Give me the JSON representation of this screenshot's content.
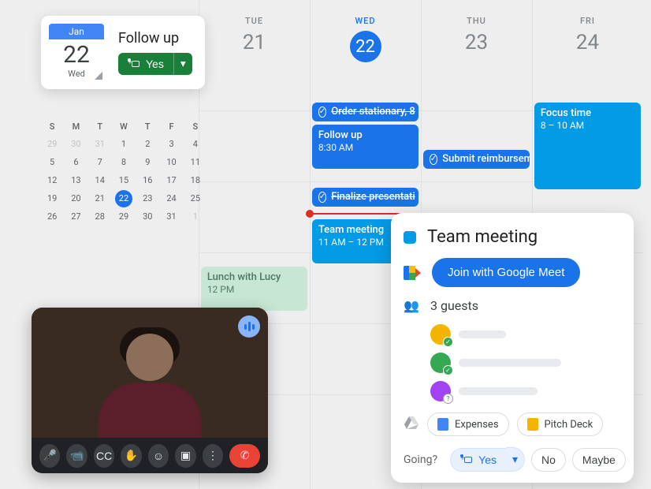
{
  "colors": {
    "blue": "#1a73e8",
    "lightBlue": "#039be5",
    "focusBlue": "#039be5",
    "green": "#188038",
    "lunch": "#c7e7d4"
  },
  "dayHeaders": [
    {
      "dow": "TUE",
      "num": "21",
      "today": false
    },
    {
      "dow": "WED",
      "num": "22",
      "today": true
    },
    {
      "dow": "THU",
      "num": "23",
      "today": false
    },
    {
      "dow": "FRI",
      "num": "24",
      "today": false
    }
  ],
  "rsvpCard": {
    "month": "Jan",
    "day": "22",
    "dow": "Wed",
    "title": "Follow up",
    "yes": "Yes"
  },
  "miniCal": {
    "dow": [
      "S",
      "M",
      "T",
      "W",
      "T",
      "F",
      "S"
    ],
    "weeks": [
      [
        {
          "n": "29",
          "dim": true
        },
        {
          "n": "30",
          "dim": true
        },
        {
          "n": "31",
          "dim": true
        },
        {
          "n": "1"
        },
        {
          "n": "2"
        },
        {
          "n": "3"
        },
        {
          "n": "4"
        }
      ],
      [
        {
          "n": "5"
        },
        {
          "n": "6"
        },
        {
          "n": "7"
        },
        {
          "n": "8"
        },
        {
          "n": "9"
        },
        {
          "n": "10"
        },
        {
          "n": "11"
        }
      ],
      [
        {
          "n": "12"
        },
        {
          "n": "13"
        },
        {
          "n": "14"
        },
        {
          "n": "15"
        },
        {
          "n": "16"
        },
        {
          "n": "17"
        },
        {
          "n": "18"
        }
      ],
      [
        {
          "n": "19"
        },
        {
          "n": "20"
        },
        {
          "n": "21"
        },
        {
          "n": "22",
          "today": true
        },
        {
          "n": "23"
        },
        {
          "n": "24"
        },
        {
          "n": "25"
        }
      ],
      [
        {
          "n": "26"
        },
        {
          "n": "27"
        },
        {
          "n": "28"
        },
        {
          "n": "29"
        },
        {
          "n": "30"
        },
        {
          "n": "31"
        },
        {
          "n": "1",
          "dim": true
        }
      ]
    ]
  },
  "events": {
    "orderStationary": {
      "label": "Order stationary, 8",
      "done": true
    },
    "followUp": {
      "title": "Follow up",
      "time": "8:30 AM"
    },
    "finalizePres": {
      "label": "Finalize presentati",
      "done": true
    },
    "teamMeeting": {
      "title": "Team meeting",
      "time": "11 AM – 12 PM"
    },
    "lunch": {
      "title": "Lunch with Lucy",
      "time": "12 PM"
    },
    "reimb": {
      "label": "Submit reimbursem",
      "done": false
    },
    "focus": {
      "title": "Focus time",
      "time": "8 – 10 AM"
    }
  },
  "detail": {
    "title": "Team meeting",
    "joinLabel": "Join with Google Meet",
    "guestsLabel": "3 guests",
    "guests": [
      {
        "color": "#f4b400",
        "status": "ok"
      },
      {
        "color": "#34a853",
        "status": "ok"
      },
      {
        "color": "#a142f4",
        "status": "q"
      }
    ],
    "attachments": [
      {
        "label": "Expenses",
        "color": "#4285f4"
      },
      {
        "label": "Pitch Deck",
        "color": "#f4b400"
      }
    ],
    "goingLabel": "Going?",
    "yes": "Yes",
    "no": "No",
    "maybe": "Maybe"
  }
}
